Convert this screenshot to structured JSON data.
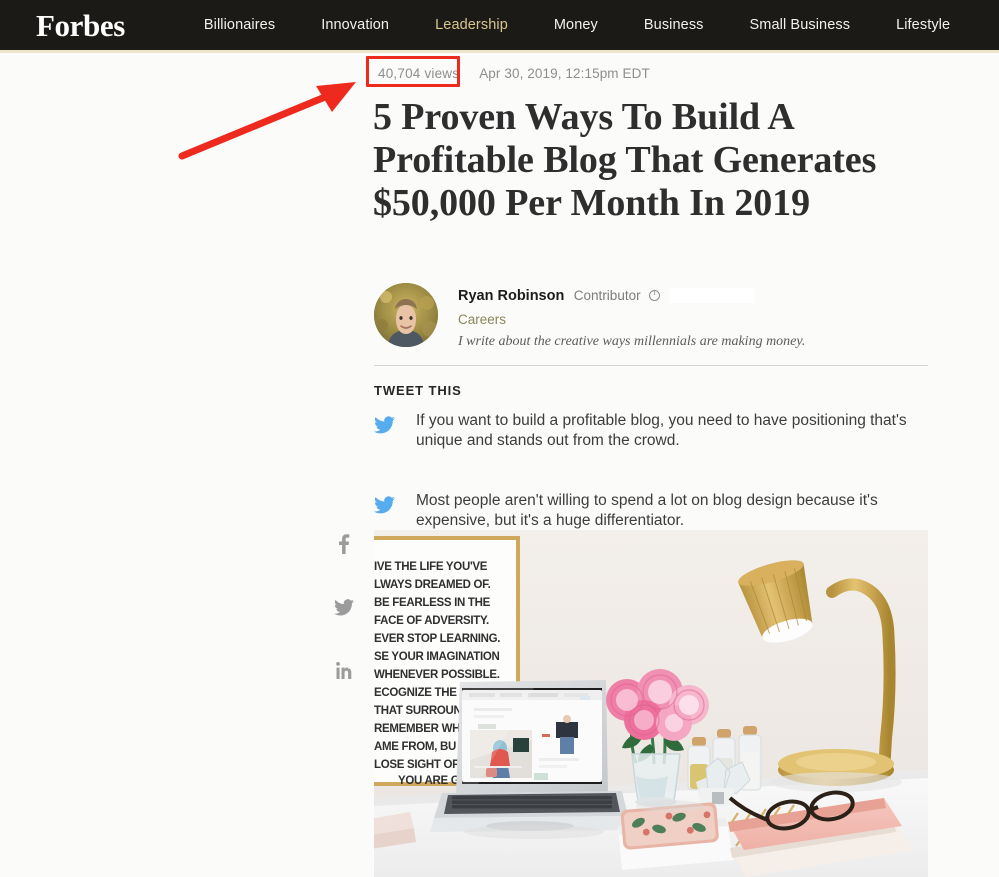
{
  "header": {
    "brand": "Forbes",
    "nav_items": [
      {
        "label": "Billionaires",
        "active": false
      },
      {
        "label": "Innovation",
        "active": false
      },
      {
        "label": "Leadership",
        "active": true
      },
      {
        "label": "Money",
        "active": false
      },
      {
        "label": "Business",
        "active": false
      },
      {
        "label": "Small Business",
        "active": false
      },
      {
        "label": "Lifestyle",
        "active": false
      }
    ],
    "active_accent": "#d8c68f",
    "bar_color": "#1b1a17"
  },
  "article": {
    "views": "40,704 views",
    "published": "Apr 30, 2019, 12:15pm EDT",
    "headline": "5 Proven Ways To Build A Profitable Blog That Generates $50,000 Per Month In 2019",
    "author": {
      "name": "Ryan Robinson",
      "role": "Contributor",
      "topic": "Careers",
      "bio": "I write about the creative ways millennials are making money."
    }
  },
  "tweet_this": {
    "heading": "TWEET THIS",
    "quotes": [
      "If you want to build a profitable blog, you need to have positioning that's unique and stands out from the crowd.",
      "Most people aren't willing to spend a lot on blog design because it's expensive, but it's a huge differentiator."
    ]
  },
  "share": {
    "items": [
      {
        "icon": "facebook-icon",
        "label": "f"
      },
      {
        "icon": "twitter-icon",
        "label": ""
      },
      {
        "icon": "linkedin-icon",
        "label": "in"
      }
    ]
  },
  "annotation": {
    "highlight_color": "#ee2a1f",
    "arrow_color": "#ee2a1f",
    "target": "40,704 views"
  },
  "hero_image": {
    "alt": "Laptop on a white desk with pink roses, gold lamp, notebooks and a motivational poster",
    "poster_lines": [
      "IVE THE LIFE YOU'VE",
      "LWAYS  DREAMED OF.",
      "BE FEARLESS IN THE",
      "FACE OF ADVERSITY.",
      "EVER STOP LEARNING.",
      "SE YOUR IMAGINATION",
      "WHENEVER POSSIBLE.",
      "ECOGNIZE THE   AUTY",
      "THAT SURROUN",
      "REMEMBER WHI",
      "AME FROM, BU",
      "LOSE SIGHT OF",
      "YOU ARE GO"
    ]
  }
}
